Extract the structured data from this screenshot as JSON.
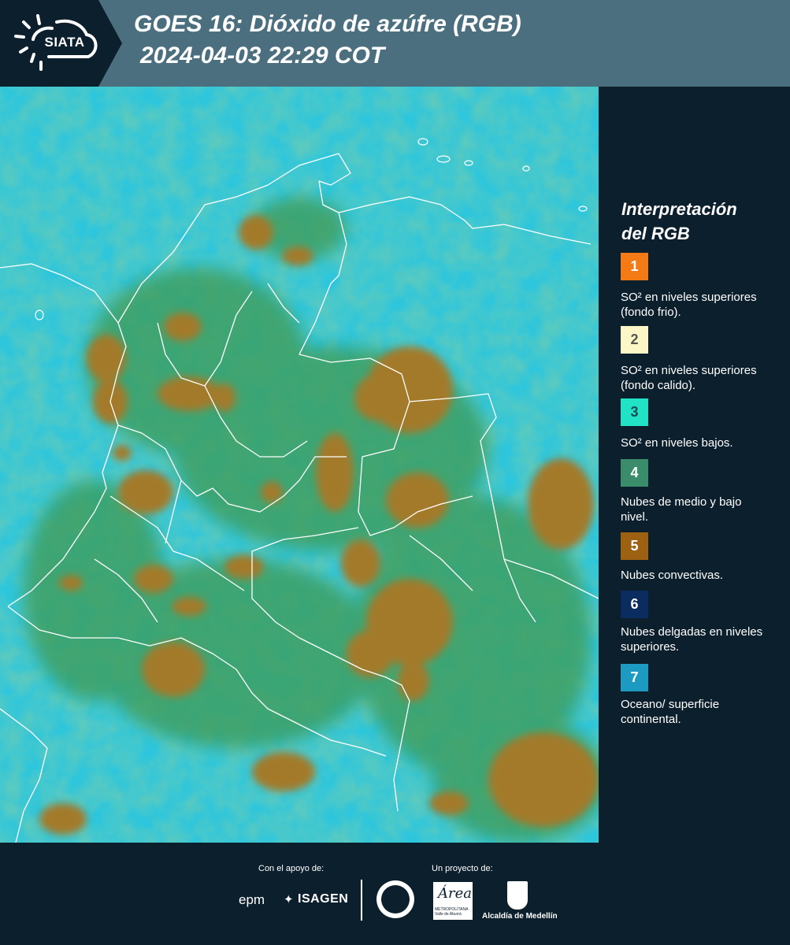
{
  "header": {
    "logo_text": "SIATA",
    "title_line1": "GOES 16: Dióxido de azúfre (RGB)",
    "title_line2": "2024-04-03 22:29 COT",
    "color": "#4b6f7e"
  },
  "legend": {
    "title_line1": "Interpretación",
    "title_line2": "del RGB",
    "items": [
      {
        "number": "1",
        "color": "#f47a16",
        "text_color": "#ffffff",
        "label": "SO² en niveles superiores (fondo frio)."
      },
      {
        "number": "2",
        "color": "#fdf7c7",
        "text_color": "#555555",
        "label": "SO² en niveles superiores (fondo calido)."
      },
      {
        "number": "3",
        "color": "#22e2c5",
        "text_color": "#1b4b55",
        "label": "SO² en niveles bajos."
      },
      {
        "number": "4",
        "color": "#3a8c6a",
        "text_color": "#ffffff",
        "label": "Nubes de medio y bajo nivel."
      },
      {
        "number": "5",
        "color": "#9c6212",
        "text_color": "#ffffff",
        "label": "Nubes convectivas."
      },
      {
        "number": "6",
        "color": "#0b2c5e",
        "text_color": "#ffffff",
        "label": "Nubes delgadas en niveles superiores."
      },
      {
        "number": "7",
        "color": "#1c9ac2",
        "text_color": "#ffffff",
        "label": "Oceano/ superficie continental."
      }
    ]
  },
  "map": {
    "background_color": "#2ec6dc",
    "vegetation_color": "#3e9a55",
    "convective_color": "#a37a2c",
    "border_color": "#ffffff"
  },
  "footer": {
    "support_label": "Con el apoyo de:",
    "project_label": "Un proyecto de:",
    "epm": "epm",
    "isagen": "ISAGEN",
    "area_logo": "Área",
    "area_sub": "METROPOLITANA Valle de Aburrá",
    "alcaldia": "Alcaldía de Medellín"
  }
}
